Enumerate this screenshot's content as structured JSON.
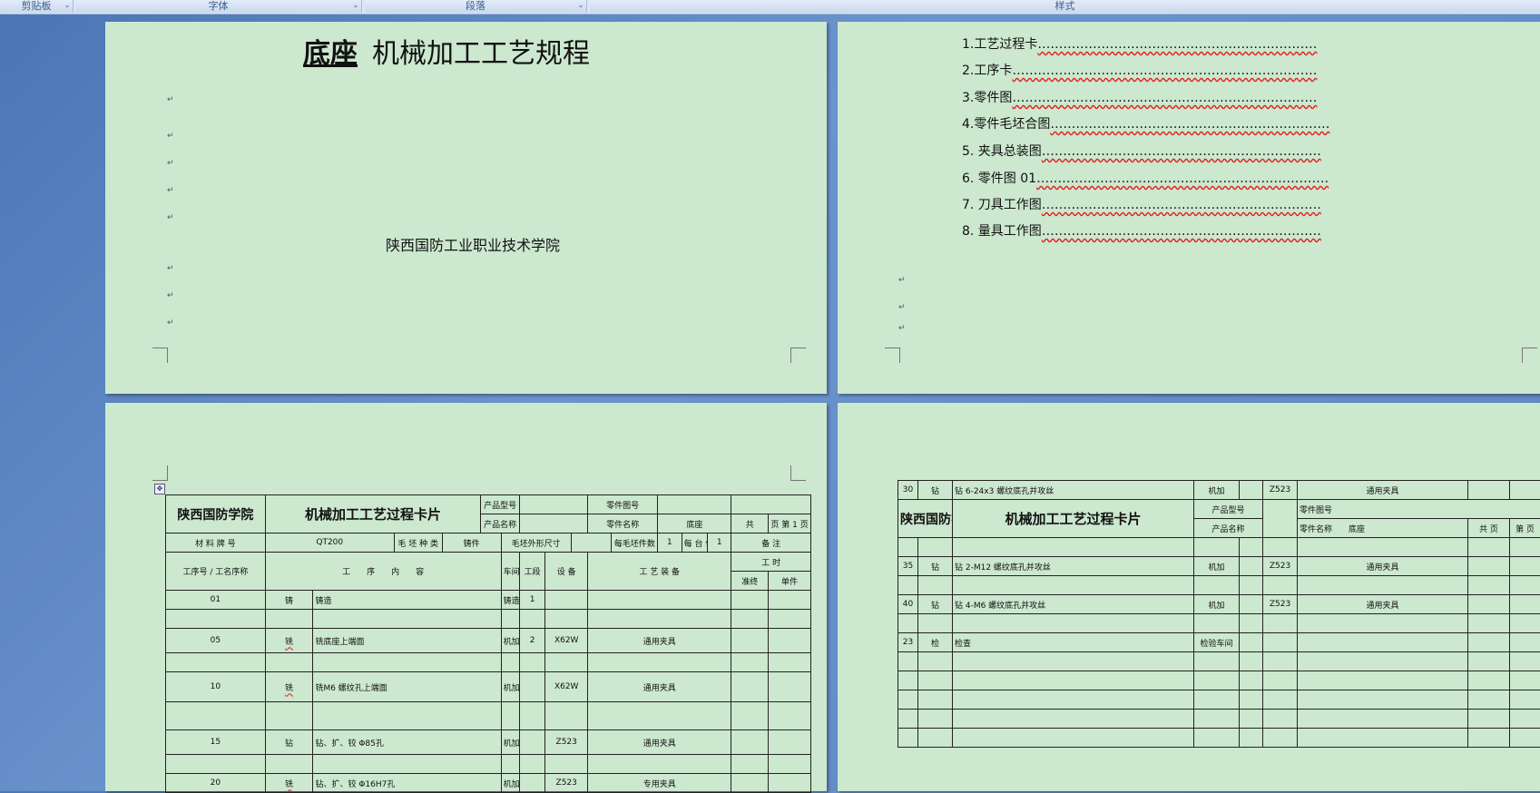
{
  "ribbon": {
    "groups": [
      "剪贴板",
      "字体",
      "段落",
      "样式"
    ],
    "launcher": "⌄"
  },
  "page1": {
    "title_bold": "底座",
    "title_rest": "机械加工工艺规程",
    "school": "陕西国防工业职业技术学院",
    "mark": "↵"
  },
  "page2": {
    "toc": [
      {
        "label": "1.工艺过程卡",
        "dots": "…………………………………………………………"
      },
      {
        "label": "2.工序卡",
        "dots": "………………………………………………………………"
      },
      {
        "label": "3.零件图",
        "dots": "………………………………………………………………"
      },
      {
        "label": "4.零件毛坯合图",
        "dots": "…………………………………………………………"
      },
      {
        "label": "5. 夹具总装图",
        "dots": "…………………………………………………………"
      },
      {
        "label": "6. 零件图 01",
        "dots": "……………………………………………………………"
      },
      {
        "label": "7. 刀具工作图",
        "dots": "…………………………………………………………"
      },
      {
        "label": "8. 量具工作图",
        "dots": "…………………………………………………………"
      }
    ]
  },
  "card": {
    "school": "陕西国防学院",
    "title": "机械加工工艺过程卡片",
    "product_model": "产品型号",
    "part_no": "零件图号",
    "product_name": "产品名称",
    "part_name": "零件名称",
    "part_name_val": "底座",
    "total": "共",
    "page_word": "页",
    "no": "第",
    "page_val": "1",
    "page_end": "页",
    "material_no": "材 料 牌 号",
    "material_val": "QT200",
    "blank_type": "毛 坯 种 类",
    "blank_val": "铸件",
    "blank_size": "毛坯外形尺寸",
    "pieces": "每毛坯件数",
    "pieces_val": "1",
    "per_unit": "每 台 件 数",
    "per_val": "1",
    "note": "备 注",
    "h_no": "工序号",
    "h_name": "工名序称",
    "h_content": "工　　序　　内　　容",
    "h_shop": "车间",
    "h_sect": "工段",
    "h_equip": "设 备",
    "h_tool": "工 艺 装 备",
    "h_time": "工 时",
    "h_prep": "准终",
    "h_unit": "单件",
    "rows": [
      {
        "no": "01",
        "name": "铸",
        "content": "铸造",
        "shop": "铸造车间",
        "sect": "1",
        "equip": "",
        "tool": ""
      },
      {
        "no": "",
        "name": "",
        "content": "",
        "shop": "",
        "sect": "",
        "equip": "",
        "tool": ""
      },
      {
        "no": "05",
        "name": "铣",
        "content": "铣底座上端面",
        "shop": "机加",
        "sect": "2",
        "equip": "X62W",
        "tool": "通用夹具"
      },
      {
        "no": "",
        "name": "",
        "content": "",
        "shop": "",
        "sect": "",
        "equip": "",
        "tool": ""
      },
      {
        "no": "10",
        "name": "铣",
        "content": "铣M6 螺纹孔上端面",
        "shop": "机加",
        "sect": "",
        "equip": "X62W",
        "tool": "通用夹具"
      },
      {
        "no": "",
        "name": "",
        "content": "",
        "shop": "",
        "sect": "",
        "equip": "",
        "tool": ""
      },
      {
        "no": "15",
        "name": "钻",
        "content": "钻、扩、铰 Φ85孔",
        "shop": "机加",
        "sect": "",
        "equip": "Z523",
        "tool": "通用夹具"
      },
      {
        "no": "",
        "name": "",
        "content": "",
        "shop": "",
        "sect": "",
        "equip": "",
        "tool": ""
      },
      {
        "no": "20",
        "name": "铣",
        "content": "钻、扩、铰 Φ16H7孔",
        "shop": "机加",
        "sect": "",
        "equip": "Z523",
        "tool": "专用夹具"
      }
    ]
  },
  "card2": {
    "top_row": {
      "no": "30",
      "name": "钻",
      "content": "钻 6-24x3 螺纹底孔并攻丝",
      "shop": "机加",
      "equip": "Z523",
      "tool": "通用夹具"
    },
    "school": "陕西国防学院",
    "title": "机械加工工艺过程卡片",
    "product_model": "产品型号",
    "part_no": "零件图号",
    "product_name": "产品名称",
    "part_name": "零件名称",
    "part_name_val": "底座",
    "total": "共 页",
    "no": "第 页",
    "rows": [
      {
        "no": "",
        "name": "",
        "content": "",
        "shop": "",
        "equip": "",
        "tool": ""
      },
      {
        "no": "35",
        "name": "钻",
        "content": "钻 2-M12 螺纹底孔并攻丝",
        "shop": "机加",
        "equip": "Z523",
        "tool": "通用夹具"
      },
      {
        "no": "",
        "name": "",
        "content": "",
        "shop": "",
        "equip": "",
        "tool": ""
      },
      {
        "no": "40",
        "name": "钻",
        "content": "钻 4-M6 螺纹底孔并攻丝",
        "shop": "机加",
        "equip": "Z523",
        "tool": "通用夹具"
      },
      {
        "no": "",
        "name": "",
        "content": "",
        "shop": "",
        "equip": "",
        "tool": ""
      },
      {
        "no": "23",
        "name": "检",
        "content": "检查",
        "shop": "检验车间",
        "equip": "",
        "tool": ""
      },
      {
        "no": "",
        "name": "",
        "content": "",
        "shop": "",
        "equip": "",
        "tool": ""
      },
      {
        "no": "",
        "name": "",
        "content": "",
        "shop": "",
        "equip": "",
        "tool": ""
      },
      {
        "no": "",
        "name": "",
        "content": "",
        "shop": "",
        "equip": "",
        "tool": ""
      },
      {
        "no": "",
        "name": "",
        "content": "",
        "shop": "",
        "equip": "",
        "tool": ""
      },
      {
        "no": "",
        "name": "",
        "content": "",
        "shop": "",
        "equip": "",
        "tool": ""
      }
    ]
  }
}
